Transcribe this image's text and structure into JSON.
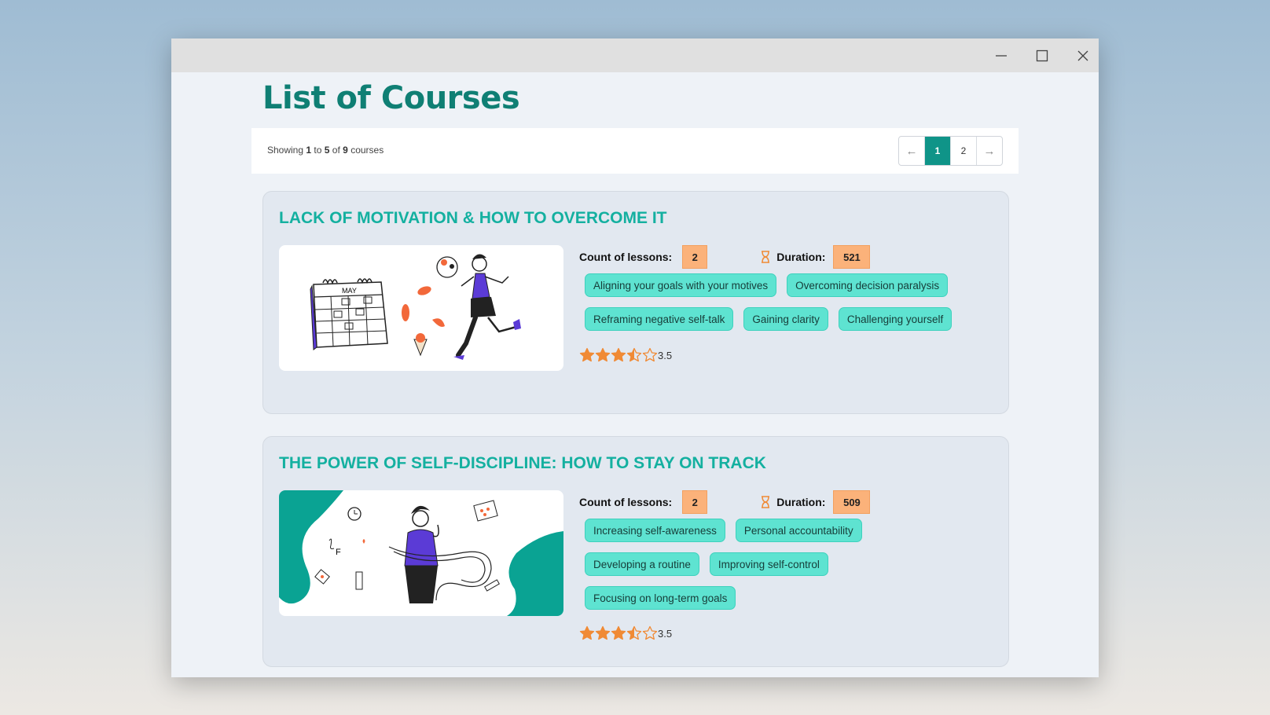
{
  "page": {
    "title": "List of Courses"
  },
  "window_controls": {
    "minimize": "minimize-icon",
    "maximize": "maximize-icon",
    "close": "close-icon"
  },
  "pager": {
    "showing_prefix": "Showing",
    "from": "1",
    "to_word": "to",
    "to": "5",
    "of_word": "of",
    "total": "9",
    "suffix": "courses",
    "pages": [
      "1",
      "2"
    ],
    "current_page": "1"
  },
  "labels": {
    "lessons": "Count of lessons:",
    "duration": "Duration:"
  },
  "courses": [
    {
      "title": "LACK OF MOTIVATION & HOW TO OVERCOME IT",
      "lessons": "2",
      "duration": "521",
      "tags": [
        "Aligning your goals with your motives",
        "Overcoming decision paralysis",
        "Reframing negative self-talk",
        "Gaining clarity",
        "Challenging yourself"
      ],
      "rating": "3.5",
      "rating_value": 3.5
    },
    {
      "title": "THE POWER OF SELF-DISCIPLINE: HOW TO STAY ON TRACK",
      "lessons": "2",
      "duration": "509",
      "tags": [
        "Increasing self-awareness",
        "Personal accountability",
        "Developing a routine",
        "Improving self-control",
        "Focusing on long-term goals"
      ],
      "rating": "3.5",
      "rating_value": 3.5
    }
  ],
  "colors": {
    "accent": "#0f9488",
    "title": "#0f7f74",
    "tag_bg": "#5ee3d1",
    "badge_bg": "#fbb27a",
    "star": "#f08a35"
  }
}
